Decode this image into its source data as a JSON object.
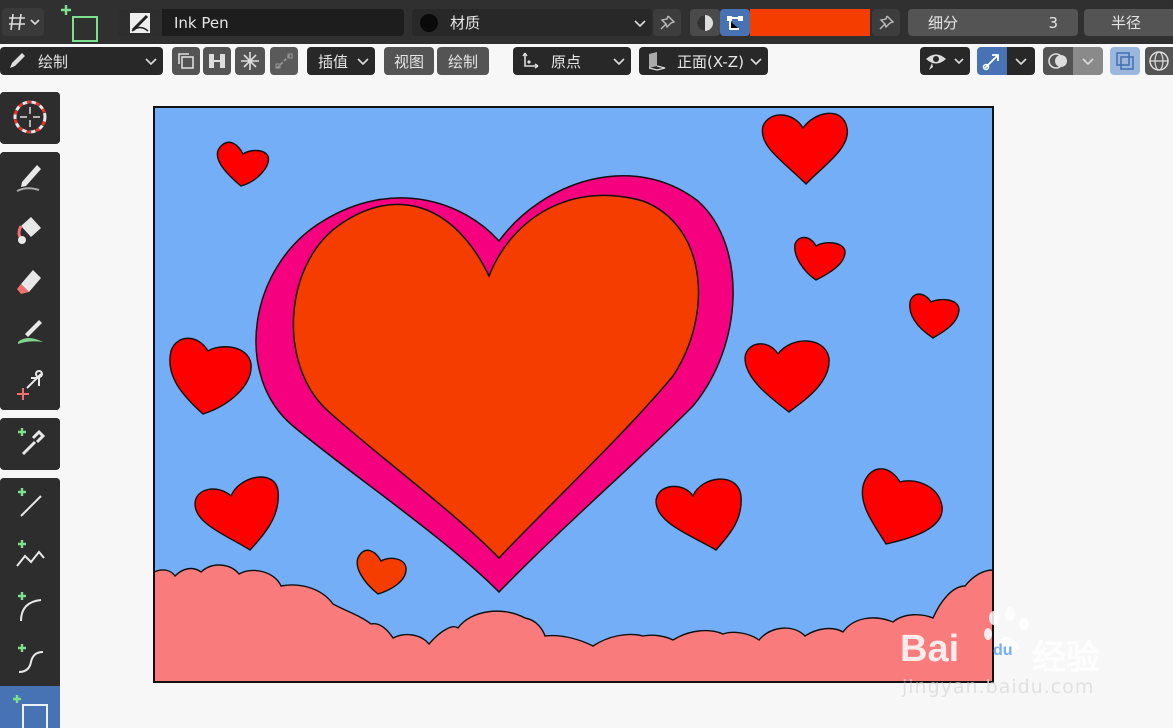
{
  "header": {
    "brush_name": "Ink Pen",
    "material_label": "材质",
    "subdivide_label": "细分",
    "subdivide_value": "3",
    "radius_label": "半径",
    "stroke_color": "#f53d00"
  },
  "toolbar": {
    "mode_label": "绘制",
    "interpolate_label": "插值",
    "view_label": "视图",
    "draw_label": "绘制",
    "origin_label": "原点",
    "plane_label": "正面(X-Z)"
  },
  "canvas": {
    "sky_color": "#74aef7",
    "big_heart_outer_color": "#f5007f",
    "big_heart_inner_color": "#f53d00",
    "small_heart_color": "#ff0000",
    "cloud_color": "#fa7b7b"
  },
  "watermark": {
    "brand": "Bai",
    "brand_suffix": "du",
    "product": "经验",
    "url": "jingyan.baidu.com"
  },
  "icons": [
    "cursor-icon",
    "pencil-icon",
    "fill-bucket-icon",
    "eraser-icon",
    "tint-brush-icon",
    "cutter-icon",
    "eyedropper-icon",
    "line-icon",
    "polyline-icon",
    "arc-icon",
    "curve-icon",
    "box-icon"
  ]
}
